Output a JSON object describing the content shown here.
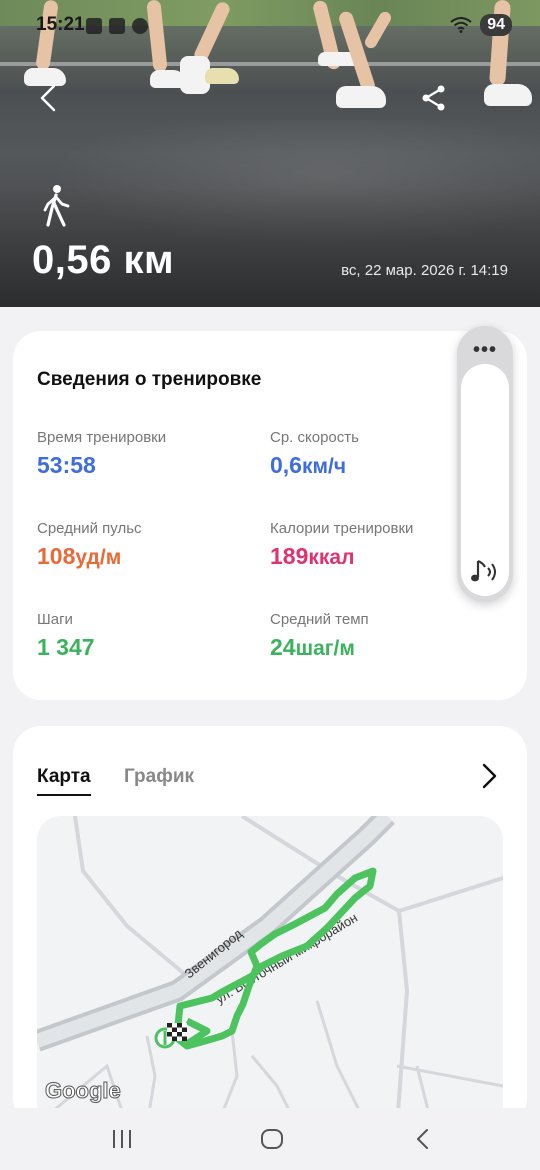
{
  "status_bar": {
    "time": "15:21",
    "battery": "94"
  },
  "hero": {
    "distance": "0,56 км",
    "datetime": "вс, 22 мар. 2026 г. 14:19"
  },
  "workout_details": {
    "title": "Сведения о тренировке",
    "metrics": [
      {
        "label": "Время тренировки",
        "value": "53:58",
        "unit": "",
        "color": "#3e6de0"
      },
      {
        "label": "Ср. скорость",
        "value": "0,6",
        "unit": "км/ч",
        "color": "#3e6de0"
      },
      {
        "label": "Средний пульс",
        "value": "108",
        "unit": "уд/м",
        "color": "#e96a36"
      },
      {
        "label": "Калории тренировки",
        "value": "189",
        "unit": "ккал",
        "color": "#e0326f"
      },
      {
        "label": "Шаги",
        "value": "1 347",
        "unit": "",
        "color": "#3ab35c"
      },
      {
        "label": "Средний темп",
        "value": "24",
        "unit": "шаг/м",
        "color": "#3ab35c"
      }
    ]
  },
  "side_panel": {
    "menu_icon": "more-dots-icon",
    "sound_icon": "music-sound-icon"
  },
  "map_card": {
    "tabs": [
      "Карта",
      "График"
    ],
    "active_tab": "Карта",
    "street_labels": [
      "Звенигород",
      "ул. Восточный микрорайон"
    ],
    "map_brand": "Google",
    "route_color": "#4cc35f"
  },
  "nav_bar": {
    "icons": [
      "recent-apps-icon",
      "home-icon",
      "back-icon"
    ]
  }
}
